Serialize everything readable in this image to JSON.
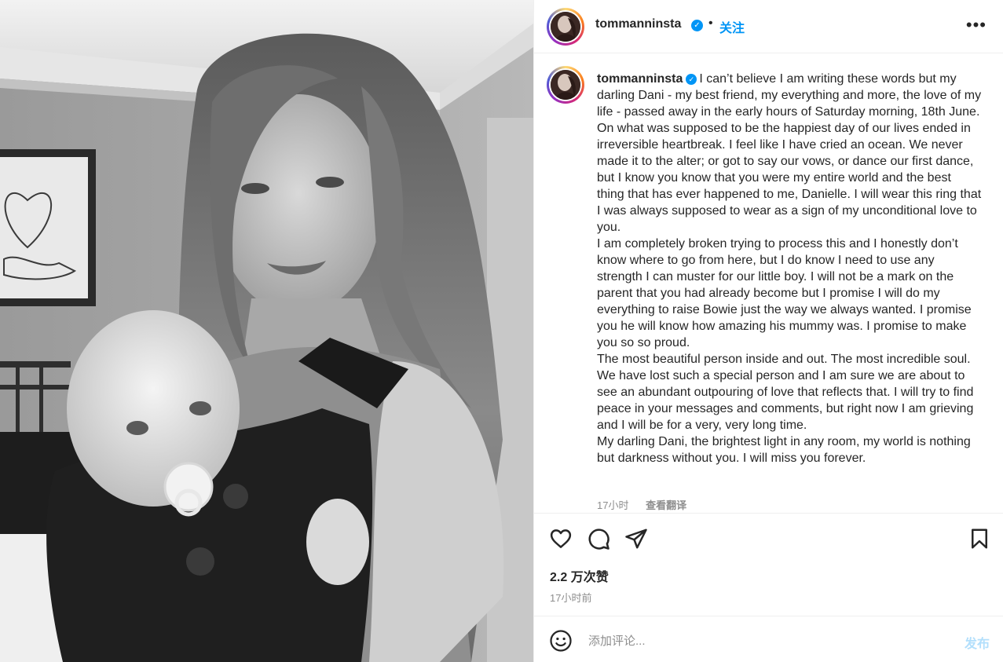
{
  "colors": {
    "accent": "#0095f6",
    "text": "#262626",
    "muted": "#8e8e8e",
    "post_disabled": "#b2dffc"
  },
  "header": {
    "username": "tommanninsta",
    "separator": "•",
    "follow_label": "关注",
    "more_glyph": "•••"
  },
  "caption": {
    "username": "tommanninsta",
    "paragraphs": [
      "I can’t believe I am writing these words but my darling Dani - my best friend, my everything and more, the love of my life - passed away in the early hours of Saturday morning, 18th June.",
      "On what was supposed to be the happiest day of our lives ended in irreversible heartbreak. I feel like I have cried an ocean. We never made it to the alter; or got to say our vows, or dance our first dance, but I know you know that you were my entire world and the best thing that has ever happened to me, Danielle. I will wear this ring that I was always supposed to wear as a sign of my unconditional love to you.",
      "I am completely broken trying to process this and I honestly don’t know where to go from here, but I do know I need to use any strength I can muster for our little boy. I will not be a mark on the parent that you had already become but I promise I will do my everything to raise Bowie just the way we always wanted. I promise you he will know how amazing his mummy was. I promise to make you so so proud.",
      "The most beautiful person inside and out. The most incredible soul. We have lost such a special person and I am sure we are about to see an abundant outpouring of love that reflects that. I will try to find peace in your messages and comments, but right now I am grieving and I will be for a very, very long time.",
      "My darling Dani, the brightest light in any room, my world is nothing but darkness without you. I will miss you forever."
    ],
    "time_ago": "17小时",
    "translate_label": "查看翻译"
  },
  "actions": {
    "icons": [
      "heart-icon",
      "comment-icon",
      "share-icon",
      "bookmark-icon"
    ]
  },
  "stats": {
    "likes": "2.2 万次赞",
    "posted": "17小时前"
  },
  "comment": {
    "placeholder": "添加评论...",
    "post_label": "发布"
  }
}
